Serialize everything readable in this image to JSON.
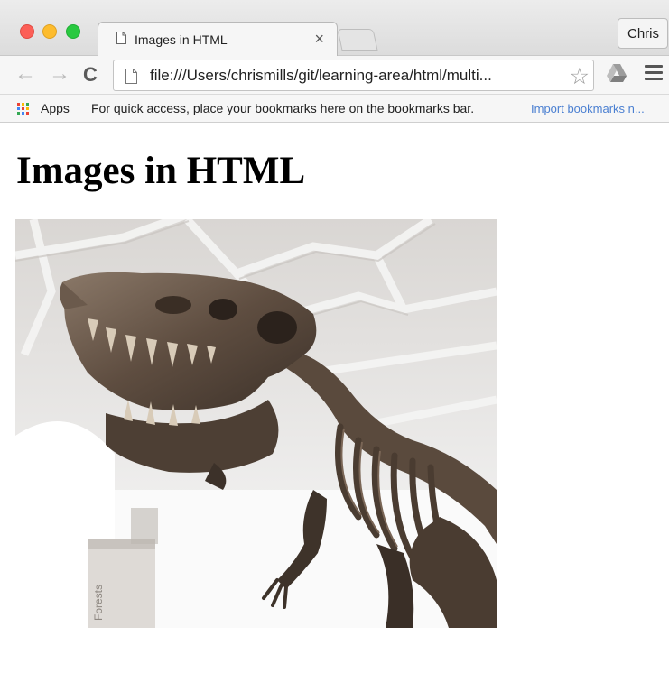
{
  "window": {
    "tab_title": "Images in HTML",
    "tab_close": "×",
    "profile_name": "Chris"
  },
  "toolbar": {
    "back": "←",
    "forward": "→",
    "reload": "C",
    "url": "file:///Users/chrismills/git/learning-area/html/multi...",
    "star": "☆"
  },
  "bookmarks_bar": {
    "apps_label": "Apps",
    "hint": "For quick access, place your bookmarks here on the bookmarks bar.",
    "import_link": "Import bookmarks n..."
  },
  "page": {
    "heading": "Images in HTML",
    "image_caption_sign": "Forests"
  },
  "colors": {
    "close": "#fc5f57",
    "minimize": "#fdbc2e",
    "zoom": "#29c940",
    "link": "#4a7fd1"
  }
}
